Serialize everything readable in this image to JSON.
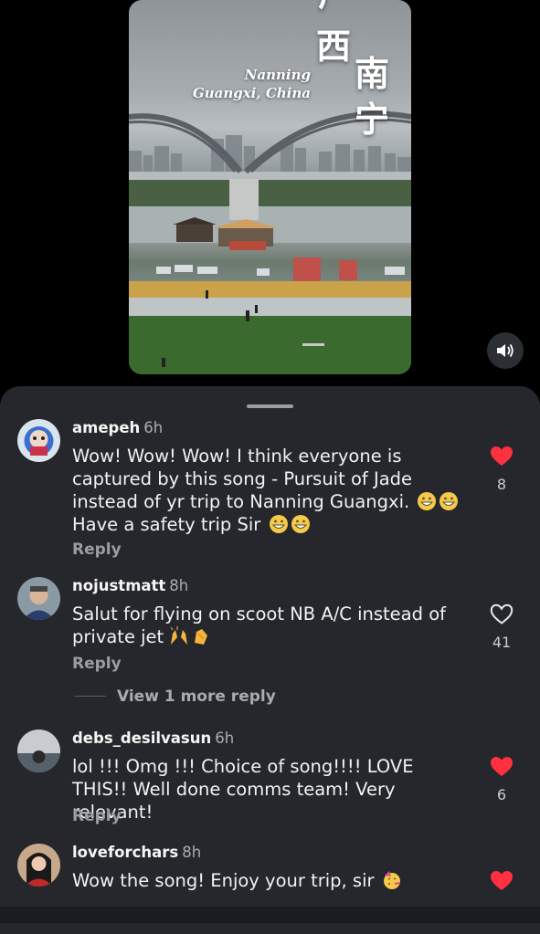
{
  "video": {
    "title_line1": "Nanning",
    "title_line2": "Guangxi, China",
    "calligraphy_chars": [
      "广",
      "西",
      "南",
      "宁"
    ],
    "mute_icon": "speaker-icon"
  },
  "comments": [
    {
      "username": "amepeh",
      "time": "6h",
      "text_parts": [
        "Wow! Wow! Wow! I think everyone is captured by this song - Pursuit of Jade instead of yr trip to Nanning Guangxi. ",
        " Have a safety trip Sir "
      ],
      "reply_label": "Reply",
      "like_count": "8",
      "liked": true
    },
    {
      "username": "nojustmatt",
      "time": "8h",
      "text": "Salut for flying on scoot NB A/C instead of private jet",
      "reply_label": "Reply",
      "like_count": "41",
      "liked": false,
      "view_more": "View 1 more reply"
    },
    {
      "username": "debs_desilvasun",
      "time": "6h",
      "text": "lol !!! Omg !!! Choice of song!!!! LOVE THIS!! Well done comms team! Very relevant!",
      "reply_label": "Reply",
      "like_count": "6",
      "liked": true
    },
    {
      "username": "loveforchars",
      "time": "8h",
      "text": "Wow the song! Enjoy your trip, sir",
      "liked": true
    }
  ],
  "colors": {
    "sheet_bg": "#25272c",
    "like_red": "#ff3040",
    "muted_text": "#a8abb0"
  }
}
